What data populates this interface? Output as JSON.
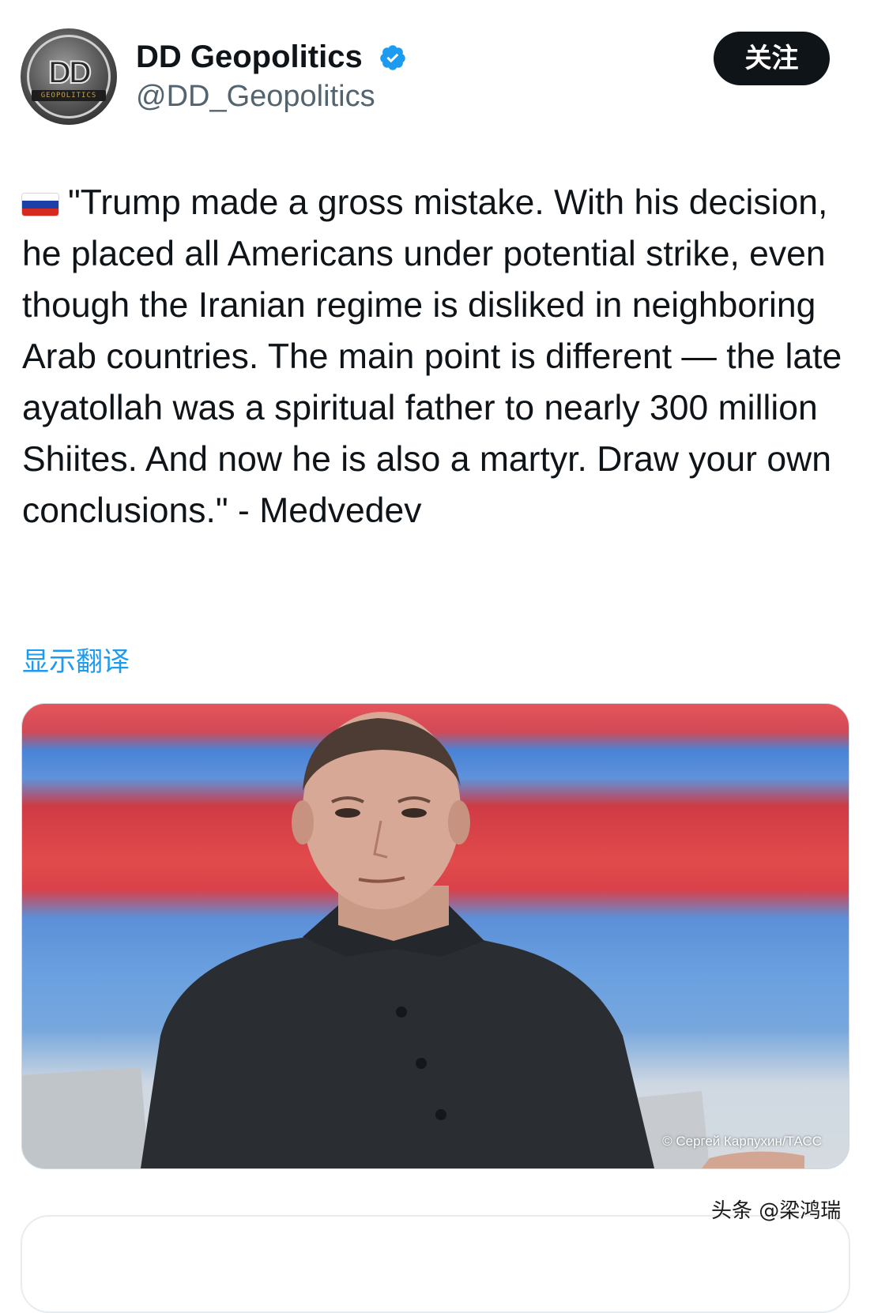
{
  "author": {
    "display_name": "DD Geopolitics",
    "handle": "@DD_Geopolitics",
    "verified": true,
    "avatar_monogram": "DD",
    "avatar_caption": "GEOPOLITICS",
    "avatar_icon": "dd-geopolitics-logo-icon",
    "verified_icon": "verified-badge-icon"
  },
  "follow_button": {
    "label": "关注"
  },
  "tweet": {
    "flag_icon": "russia-flag-icon",
    "text": "\"Trump made a gross mistake. With his decision, he placed all Americans under potential strike, even though the Iranian regime is disliked in neighboring Arab countries. The main point is different — the late ayatollah was a spiritual father to nearly 300 million Shiites. And now he is also a martyr. Draw your own conclusions.\" - Medvedev",
    "translate_label": "显示翻译"
  },
  "media": {
    "photo_credit": "© Сергей Карпухин/ТАСС"
  },
  "watermark": {
    "text": "头条 @梁鸿瑞"
  },
  "colors": {
    "text_primary": "#0f1419",
    "text_secondary": "#536471",
    "link": "#1d9bf0",
    "verified": "#1d9bf0",
    "button_bg": "#0f1419",
    "button_text": "#ffffff"
  }
}
